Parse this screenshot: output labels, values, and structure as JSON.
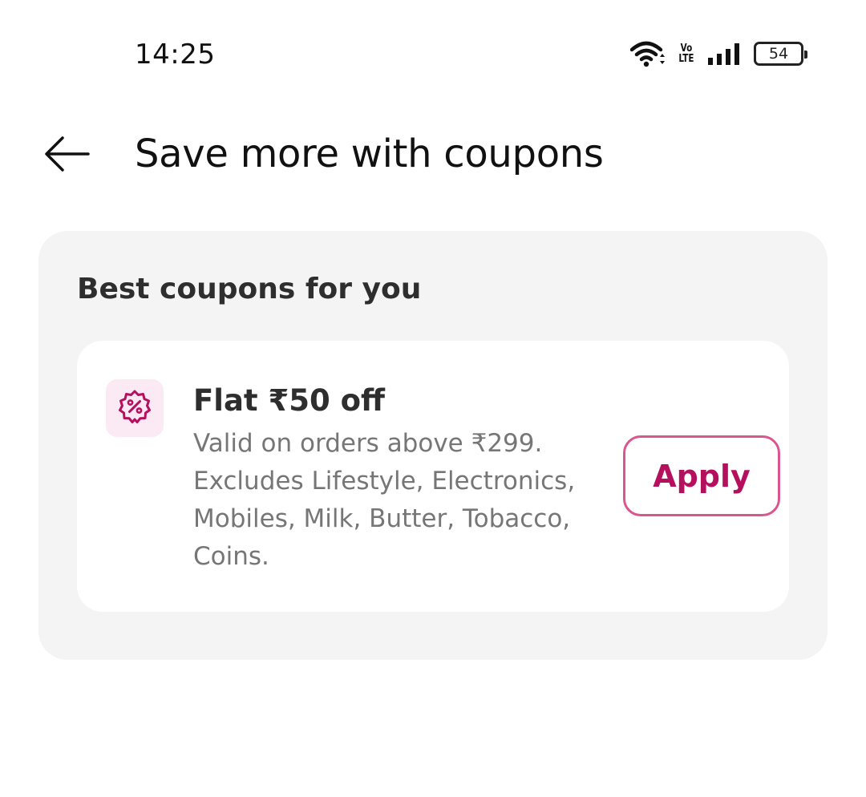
{
  "status_bar": {
    "time": "14:25",
    "icons": [
      "wifi-icon",
      "volte-icon",
      "signal-icon",
      "battery-icon"
    ],
    "volte_top": "Vo",
    "volte_bottom": "LTE",
    "battery_level": "54"
  },
  "header": {
    "back_icon": "back-arrow-icon",
    "title": "Save more with coupons"
  },
  "coupons": {
    "heading": "Best coupons for you",
    "items": [
      {
        "icon": "discount-badge-icon",
        "title": "Flat ₹50 off",
        "description": "Valid on orders above ₹299. Excludes Lifestyle, Electronics, Mobiles, Milk, Butter, Tobacco, Coins.",
        "action_label": "Apply"
      }
    ]
  },
  "colors": {
    "accent": "#b5105e",
    "accent_border": "#d9578f",
    "icon_bg": "#fbe9f3",
    "panel_bg": "#f4f4f4"
  }
}
